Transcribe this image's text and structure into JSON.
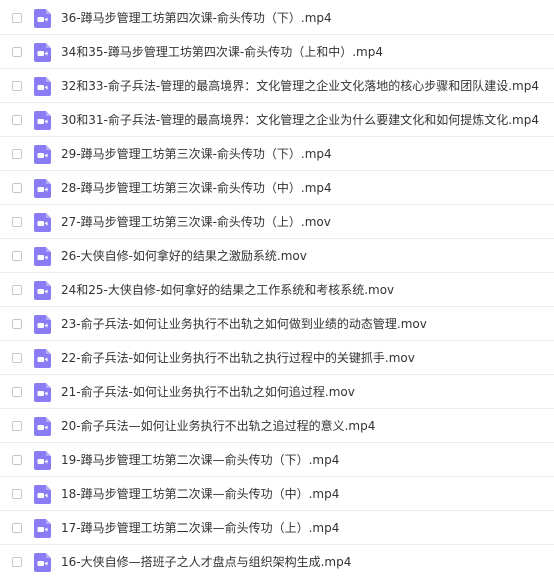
{
  "colors": {
    "video_icon": "#8a7cf5",
    "text": "#333333",
    "divider": "#ededed",
    "checkbox_border": "#c7c7c7"
  },
  "icons": {
    "file_type": "video-file-icon",
    "select": "checkbox"
  },
  "files": [
    {
      "name": "36-蹲马步管理工坊第四次课-俞头传功（下）.mp4"
    },
    {
      "name": "34和35-蹲马步管理工坊第四次课-俞头传功（上和中）.mp4"
    },
    {
      "name": "32和33-俞子兵法-管理的最高境界：文化管理之企业文化落地的核心步骤和团队建设.mp4"
    },
    {
      "name": "30和31-俞子兵法-管理的最高境界：文化管理之企业为什么要建文化和如何提炼文化.mp4"
    },
    {
      "name": "29-蹲马步管理工坊第三次课-俞头传功（下）.mp4"
    },
    {
      "name": "28-蹲马步管理工坊第三次课-俞头传功（中）.mp4"
    },
    {
      "name": "27-蹲马步管理工坊第三次课-俞头传功（上）.mov"
    },
    {
      "name": "26-大侠自修-如何拿好的结果之激励系统.mov"
    },
    {
      "name": "24和25-大侠自修-如何拿好的结果之工作系统和考核系统.mov"
    },
    {
      "name": "23-俞子兵法-如何让业务执行不出轨之如何做到业绩的动态管理.mov"
    },
    {
      "name": "22-俞子兵法-如何让业务执行不出轨之执行过程中的关键抓手.mov"
    },
    {
      "name": "21-俞子兵法-如何让业务执行不出轨之如何追过程.mov"
    },
    {
      "name": "20-俞子兵法—如何让业务执行不出轨之追过程的意义.mp4"
    },
    {
      "name": "19-蹲马步管理工坊第二次课—俞头传功（下）.mp4"
    },
    {
      "name": "18-蹲马步管理工坊第二次课—俞头传功（中）.mp4"
    },
    {
      "name": "17-蹲马步管理工坊第二次课—俞头传功（上）.mp4"
    },
    {
      "name": "16-大侠自修—搭班子之人才盘点与组织架构生成.mp4"
    }
  ]
}
